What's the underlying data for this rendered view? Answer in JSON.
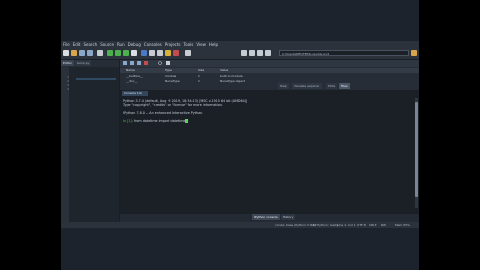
{
  "menubar": {
    "items": [
      "File",
      "Edit",
      "Search",
      "Source",
      "Run",
      "Debug",
      "Consoles",
      "Projects",
      "Tools",
      "View",
      "Help"
    ]
  },
  "toolbar": {
    "path": "C:\\Users\\INFOTEKS\\.spyder-py3"
  },
  "project_pane": {
    "tabs": [
      {
        "label": "Editor",
        "active": true
      },
      {
        "label": "temp.py",
        "active": false
      }
    ],
    "line_numbers": [
      "1",
      "2",
      "3",
      "4"
    ]
  },
  "variable_explorer": {
    "columns": [
      "Name",
      "Type",
      "Size",
      "Value"
    ],
    "rows": [
      {
        "name": "__builtins__",
        "type": "module",
        "size": "1",
        "value": "built-in module"
      },
      {
        "name": "__doc__",
        "type": "NoneType",
        "size": "1",
        "value": "NoneType object"
      }
    ],
    "mid_tabs": [
      {
        "label": "Help",
        "active": false
      },
      {
        "label": "Variable explorer",
        "active": false
      },
      {
        "label": "Plots",
        "active": false
      },
      {
        "label": "Files",
        "active": true
      }
    ]
  },
  "console": {
    "tab_label": "Console 1/A",
    "lines": [
      "Python 3.7.4 (default, Aug  9 2019, 18:34:13) [MSC v.1915 64 bit (AMD64)]",
      "Type \"copyright\", \"credits\" or \"license\" for more information.",
      "",
      "IPython 7.8.0 -- An enhanced Interactive Python."
    ],
    "prompt": "In [1]:",
    "command": "from datetime import datetime"
  },
  "bottom_tabs": [
    {
      "label": "IPython console",
      "active": true
    },
    {
      "label": "History",
      "active": false
    }
  ],
  "statusbar": {
    "items": [
      "conda: base (Python 3.7.4)",
      "LSP Python: ready",
      "Line 1, Col 1",
      "UTF-8",
      "CRLF",
      "RW",
      "Mem 65%"
    ]
  },
  "colors": {
    "prompt": "#4fc04f",
    "background": "#232a34",
    "accent": "#2f4a63"
  }
}
